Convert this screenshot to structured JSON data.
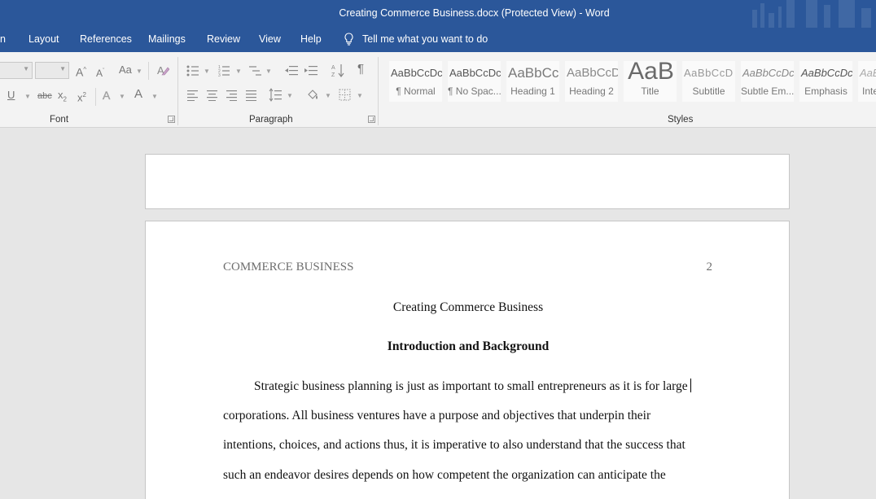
{
  "window": {
    "title": "Creating Commerce Business.docx (Protected View)  -  Word"
  },
  "tabs": [
    {
      "label": "n"
    },
    {
      "label": "Layout"
    },
    {
      "label": "References"
    },
    {
      "label": "Mailings"
    },
    {
      "label": "Review"
    },
    {
      "label": "View"
    },
    {
      "label": "Help"
    }
  ],
  "tell_me": {
    "label": "Tell me what you want to do"
  },
  "ribbon": {
    "font": {
      "label": "Font",
      "change_case": "Aa",
      "underline": "U",
      "strikethrough": "abc",
      "subscript": "x",
      "subscript_sub": "2",
      "superscript": "x",
      "superscript_sup": "2",
      "text_effects": "A",
      "font_color": "A",
      "grow": "A",
      "shrink": "A"
    },
    "paragraph": {
      "label": "Paragraph",
      "pilcrow": "¶"
    },
    "styles": {
      "label": "Styles",
      "items": [
        {
          "preview": "AaBbCcDc",
          "name": "¶ Normal"
        },
        {
          "preview": "AaBbCcDc",
          "name": "¶ No Spac..."
        },
        {
          "preview": "AaBbCc",
          "name": "Heading 1"
        },
        {
          "preview": "AaBbCcD",
          "name": "Heading 2"
        },
        {
          "preview": "AaB",
          "name": "Title"
        },
        {
          "preview": "AaBbCcD",
          "name": "Subtitle"
        },
        {
          "preview": "AaBbCcDc",
          "name": "Subtle Em..."
        },
        {
          "preview": "AaBbCcDc",
          "name": "Emphasis"
        },
        {
          "preview": "AaBb",
          "name": "Inte"
        }
      ]
    }
  },
  "document": {
    "header_left": "COMMERCE BUSINESS",
    "page_number": "2",
    "title": "Creating Commerce Business",
    "heading": "Introduction and Background",
    "lines": [
      "Strategic business planning is just as important to small entrepreneurs as it is for large",
      "corporations. All business ventures have a purpose and objectives that underpin their",
      "intentions, choices, and actions thus, it is imperative to also understand that the success that",
      "such an endeavor desires depends on how competent the organization can anticipate the"
    ]
  }
}
